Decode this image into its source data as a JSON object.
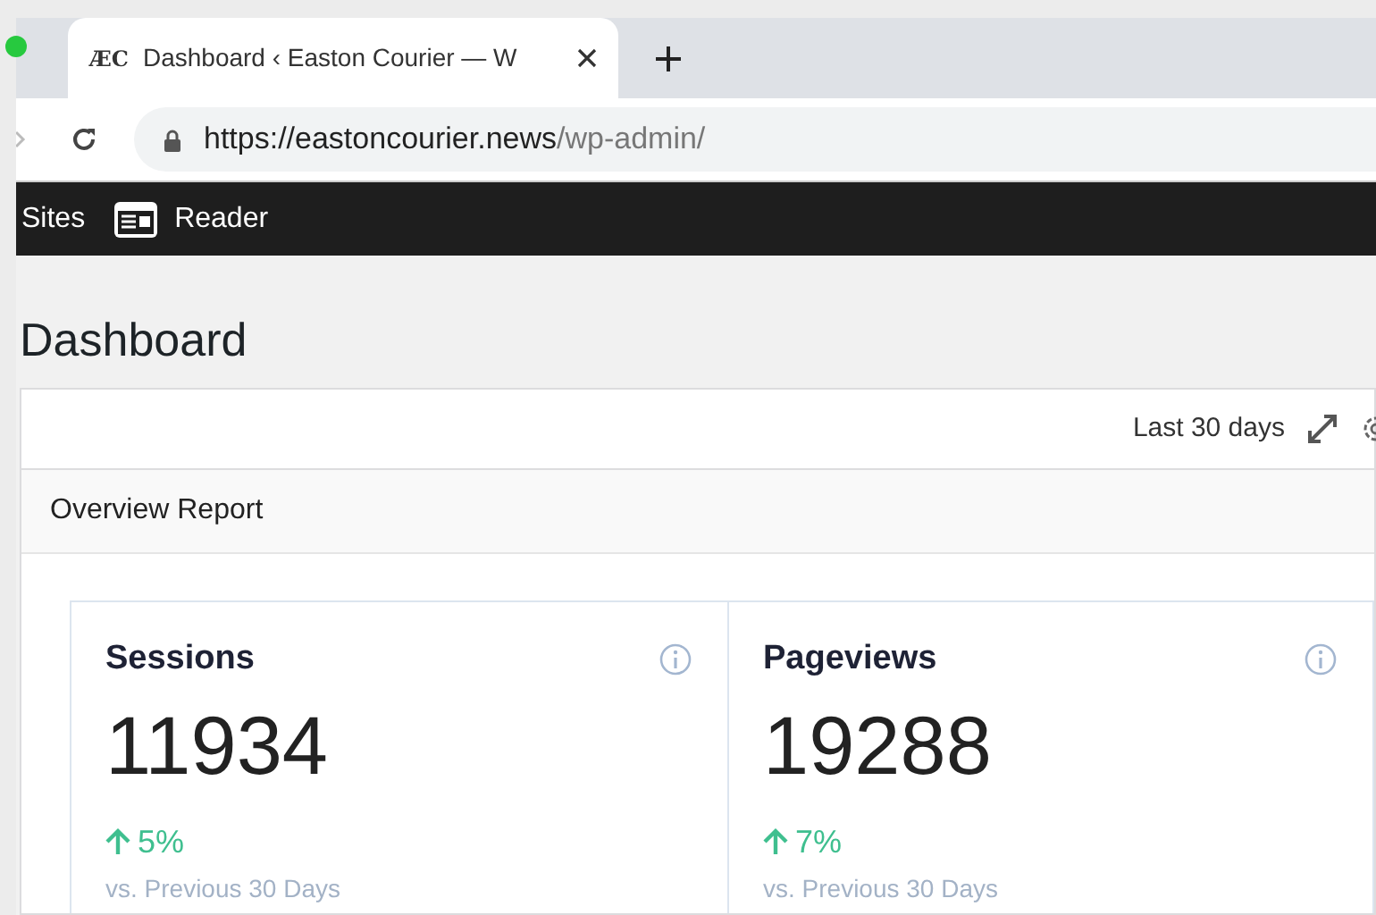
{
  "browser": {
    "tab": {
      "favicon_text": "ÆC",
      "title": "Dashboard ‹ Easton Courier — W",
      "selected": true
    },
    "url_host": "https://eastoncourier.news",
    "url_path": "/wp-admin/"
  },
  "admin_bar": {
    "items": [
      {
        "label": "Sites",
        "kind": "text"
      },
      {
        "label": "Reader",
        "kind": "reader"
      }
    ]
  },
  "page_title": "Dashboard",
  "widget": {
    "range": "Last 30 days",
    "report_title": "Overview Report",
    "stats": [
      {
        "label": "Sessions",
        "value": "11934",
        "kind": "increase",
        "change": "5%",
        "comparison": "vs. Previous 30 Days"
      },
      {
        "label": "Pageviews",
        "value": "19288",
        "kind": "increase",
        "change": "7%",
        "comparison": "vs. Previous 30 Days"
      }
    ]
  }
}
